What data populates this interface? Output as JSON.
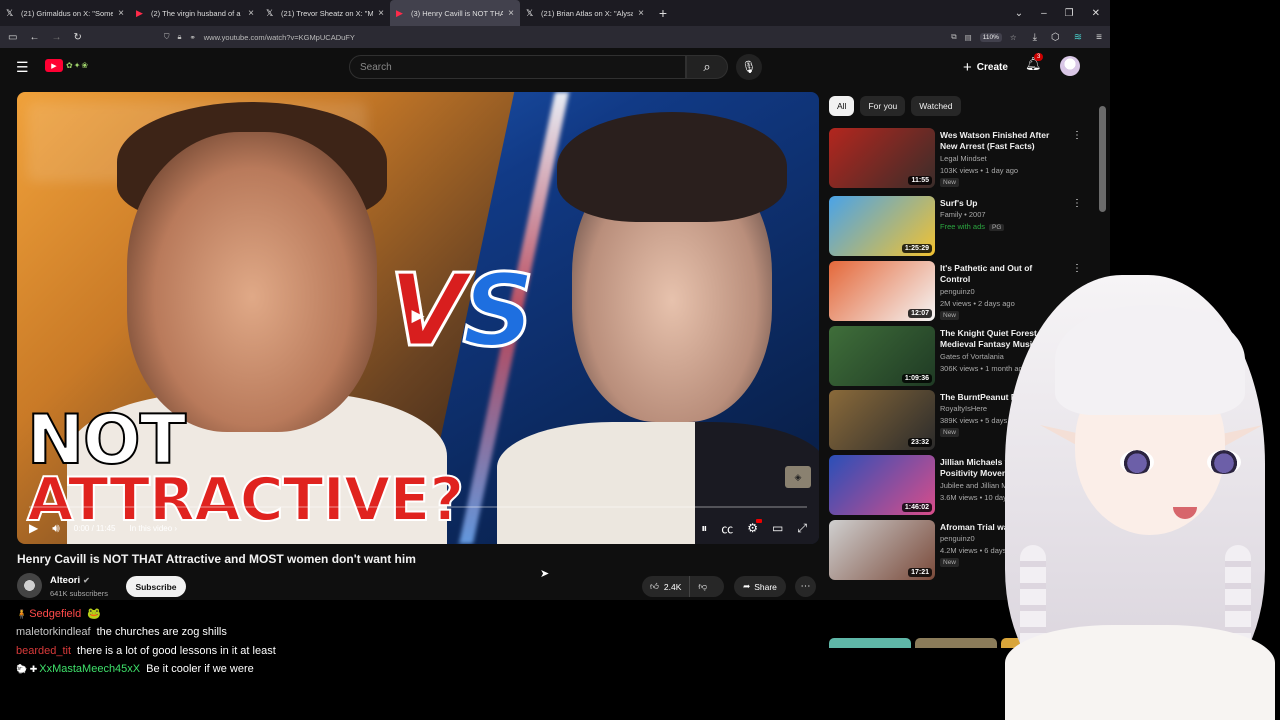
{
  "browser": {
    "tabs": [
      {
        "label": "(21) Grimaldus on X: \"Someone",
        "icon": "𝕏",
        "active": false,
        "kind": "x"
      },
      {
        "label": "(2) The virgin husband of a \"for",
        "icon": "▶",
        "active": false,
        "kind": "yt"
      },
      {
        "label": "(21) Trevor Sheatz on X: \"My wi",
        "icon": "𝕏",
        "active": false,
        "kind": "x"
      },
      {
        "label": "(3) Henry Cavill is NOT THAT At",
        "icon": "▶",
        "active": true,
        "kind": "yt"
      },
      {
        "label": "(21) Brian Atlas on X: \"Alysa Liu",
        "icon": "𝕏",
        "active": false,
        "kind": "x"
      }
    ],
    "url": "www.youtube.com/watch?v=KGMpUCADuFY",
    "zoom": "110%"
  },
  "youtube": {
    "search_placeholder": "Search",
    "create_label": "Create",
    "notification_count": "3",
    "player": {
      "vs_v": "V",
      "vs_s": "S",
      "headline_line1": "NOT",
      "headline_line2": "ATTRACTIVE?",
      "time": "0:00 / 11:45",
      "chapter": "In this video ›",
      "progress_fraction": 0
    },
    "video": {
      "title": "Henry Cavill is NOT THAT Attractive and MOST women don't want him",
      "channel": "Alteori",
      "subscribers": "641K subscribers",
      "subscribe_label": "Subscribe",
      "likes": "2.4K",
      "share_label": "Share"
    },
    "chips": [
      "All",
      "For you",
      "Watched"
    ],
    "recommendations": [
      {
        "title": "Wes Watson Finished After New Arrest (Fast Facts)",
        "channel": "Legal Mindset",
        "meta": "103K views • 1 day ago",
        "badge": "New",
        "duration": "11:55",
        "thumb_colors": [
          "#b3261e",
          "#3a2d2a"
        ]
      },
      {
        "title": "Surf's Up",
        "channel": "Family • 2007",
        "meta": "Free with ads",
        "rating": "PG",
        "duration": "1:25:29",
        "thumb_colors": [
          "#4aa3e8",
          "#f2c230"
        ]
      },
      {
        "title": "It's Pathetic and Out of Control",
        "channel": "penguinz0",
        "meta": "2M views • 2 days ago",
        "badge": "New",
        "duration": "12:07",
        "thumb_colors": [
          "#e4683a",
          "#f5f5f5"
        ]
      },
      {
        "title": "The Knight Quiet Forest | Medieval Fantasy Music for ...",
        "channel": "Gates of Vortalania",
        "meta": "306K views • 1 month ago",
        "badge": "",
        "duration": "1:09:36",
        "thumb_colors": [
          "#3f6e3a",
          "#1f3a24"
        ]
      },
      {
        "title": "The BurntPeanut Problem",
        "channel": "RoyaltyIsHere",
        "meta": "389K views • 5 days ago",
        "badge": "New",
        "duration": "23:32",
        "thumb_colors": [
          "#8a6a3a",
          "#2b2b2b"
        ]
      },
      {
        "title": "Jillian Michaels vs The Positivity Movement",
        "channel": "Jubilee and Jillian Mi",
        "meta": "3.6M views • 10 days ago",
        "badge": "",
        "duration": "1:46:02",
        "thumb_colors": [
          "#2a4fb8",
          "#d94d8a"
        ]
      },
      {
        "title": "Afroman Trial was Crazy",
        "channel": "penguinz0",
        "meta": "4.2M views • 6 days ago",
        "badge": "New",
        "duration": "17:21",
        "thumb_colors": [
          "#cfcfcf",
          "#7a4a3a"
        ]
      }
    ]
  },
  "chat": [
    {
      "badges": "🧍",
      "user": "Sedgefield",
      "user_color": "#ff4a4a",
      "text": "🐸"
    },
    {
      "badges": "",
      "user": "maletorkindleaf",
      "user_color": "#c8c8c8",
      "text": "the churches are zog shills"
    },
    {
      "badges": "",
      "user": "bearded_tit",
      "user_color": "#d93a3a",
      "text": "there is a lot of good lessons in it at least"
    },
    {
      "badges": "🐑 ✚",
      "user": "XxMastaMeech45xX",
      "user_color": "#3ee06a",
      "text": "Be it cooler if we were"
    }
  ]
}
